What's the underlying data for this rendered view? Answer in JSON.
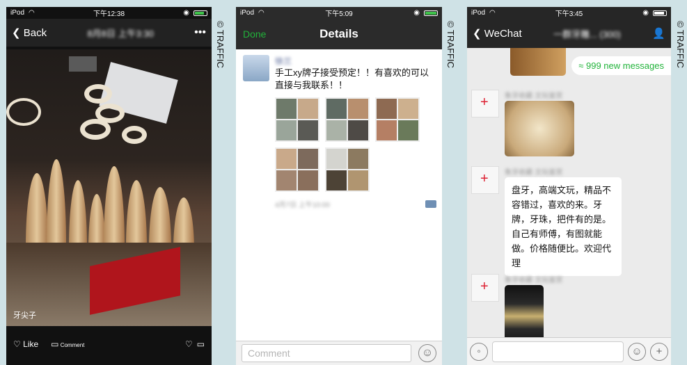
{
  "watermark": "© TRAFFIC",
  "phone1": {
    "status": {
      "carrier": "iPod",
      "time": "下午12:38"
    },
    "back_label": "Back",
    "title": "8月8日 上午3:30",
    "more_label": "•••",
    "caption": "牙尖子",
    "like_label": "Like",
    "comment_label": "Comment"
  },
  "phone2": {
    "status": {
      "carrier": "iPod",
      "time": "下午5:09"
    },
    "done_label": "Done",
    "title": "Details",
    "post_name": "徐兰",
    "post_text": "手工xy牌子接受预定！！有喜欢的可以直接与我联系！！",
    "post_meta": "4月7日 上午10:00",
    "comment_placeholder": "Comment"
  },
  "phone3": {
    "status": {
      "carrier": "iPod",
      "time": "下午3:45"
    },
    "back_label": "WeChat",
    "title": "一群牙雕... (300)",
    "new_messages": "999 new messages",
    "sender": "象牙收藏·文玩鉴赏",
    "message_text": "盘牙，高端文玩，精品不容错过，喜欢的来。牙牌，牙珠，把件有的是。自己有师傅，有图就能做。价格随便比。欢迎代理"
  }
}
